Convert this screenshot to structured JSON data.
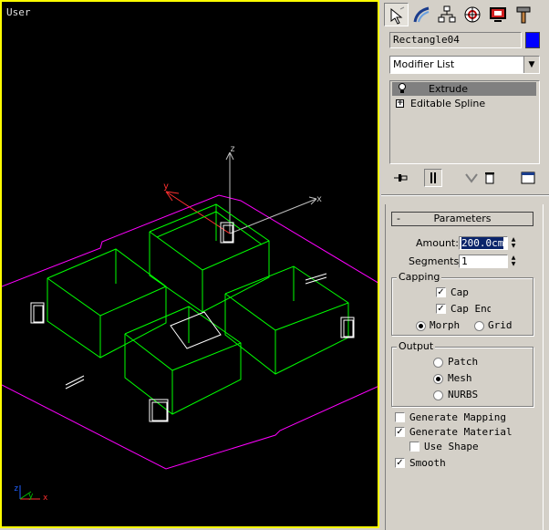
{
  "viewport": {
    "label": "User",
    "border_color": "#ffff00",
    "wire_color": "#00ff00",
    "grid_color": "#ff00ff"
  },
  "axis_gizmo": {
    "x": "x",
    "y": "y",
    "z": "z"
  },
  "corner_axes": {
    "x": "x",
    "y": "y",
    "z": "z"
  },
  "tabs": [
    {
      "name": "create-tab",
      "icon": "create-icon",
      "active": true
    },
    {
      "name": "modify-tab",
      "icon": "modify-icon",
      "active": false
    },
    {
      "name": "hierarchy-tab",
      "icon": "hierarchy-icon",
      "active": false
    },
    {
      "name": "motion-tab",
      "icon": "motion-icon",
      "active": false
    },
    {
      "name": "display-tab",
      "icon": "display-icon",
      "active": false
    },
    {
      "name": "utilities-tab",
      "icon": "utilities-icon",
      "active": false
    }
  ],
  "object": {
    "name": "Rectangle04",
    "color": "#0000ff"
  },
  "modifier_list": {
    "selected": "Modifier List"
  },
  "modifier_stack": [
    {
      "label": "Extrude",
      "selected": true
    },
    {
      "label": "Editable Spline",
      "selected": false
    }
  ],
  "rollout": {
    "title": "Parameters",
    "collapse": "-"
  },
  "params": {
    "amount_label": "Amount:",
    "amount_value": "200.0cm",
    "segments_label": "Segments:",
    "segments_value": "1"
  },
  "capping": {
    "title": "Capping",
    "cap_start": {
      "label": "Cap",
      "checked": true
    },
    "cap_end": {
      "label": "Cap End",
      "checked": true
    },
    "morph": {
      "label": "Morph",
      "checked": true
    },
    "grid": {
      "label": "Grid",
      "checked": false
    }
  },
  "output": {
    "title": "Output",
    "patch": {
      "label": "Patch",
      "checked": false
    },
    "mesh": {
      "label": "Mesh",
      "checked": true
    },
    "nurbs": {
      "label": "NURBS",
      "checked": false
    }
  },
  "options": {
    "gen_mapping": {
      "label": "Generate Mapping",
      "checked": false
    },
    "gen_material": {
      "label": "Generate Material",
      "checked": true
    },
    "use_shape": {
      "label": "Use Shape",
      "checked": false
    },
    "smooth": {
      "label": "Smooth",
      "checked": true
    }
  }
}
